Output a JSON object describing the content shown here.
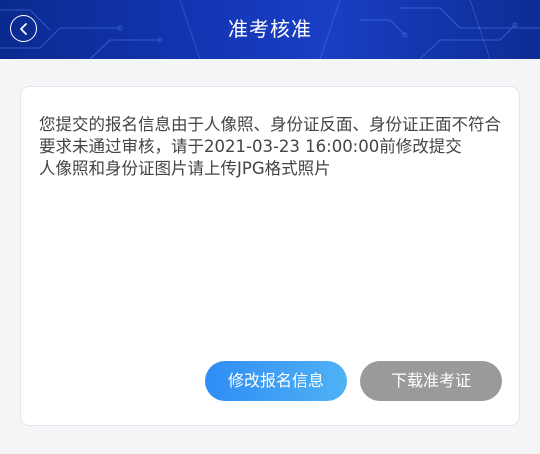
{
  "header": {
    "title": "准考核准",
    "back_icon": "chevron-left-icon"
  },
  "notice": {
    "line1": "您提交的报名信息由于人像照、身份证反面、身份证正面不符合要求未通过审核，请于2021-03-23 16:00:00前修改提交",
    "line2": "人像照和身份证图片请上传JPG格式照片"
  },
  "actions": {
    "edit_label": "修改报名信息",
    "download_label": "下载准考证"
  },
  "colors": {
    "header_bg": "#1436b6",
    "primary_button": "#2f8df5",
    "disabled_button": "#9a9a9a"
  }
}
